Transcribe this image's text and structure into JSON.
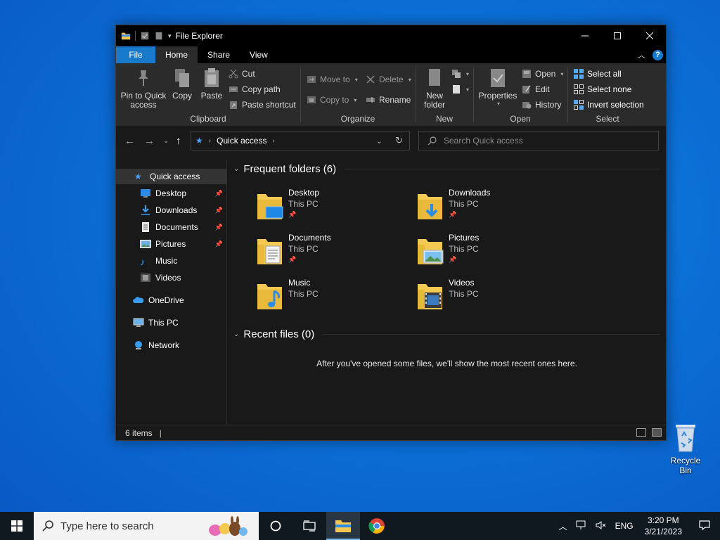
{
  "window": {
    "title": "File Explorer",
    "ribbon_tabs": [
      "File",
      "Home",
      "Share",
      "View"
    ],
    "help": "?"
  },
  "ribbon": {
    "clipboard": {
      "label": "Clipboard",
      "pin": "Pin to Quick access",
      "copy": "Copy",
      "paste": "Paste",
      "cut": "Cut",
      "copy_path": "Copy path",
      "paste_shortcut": "Paste shortcut"
    },
    "organize": {
      "label": "Organize",
      "move_to": "Move to",
      "copy_to": "Copy to",
      "delete": "Delete",
      "rename": "Rename"
    },
    "new": {
      "label": "New",
      "new_folder": "New folder"
    },
    "open": {
      "label": "Open",
      "properties": "Properties",
      "open": "Open",
      "edit": "Edit",
      "history": "History"
    },
    "select": {
      "label": "Select",
      "select_all": "Select all",
      "select_none": "Select none",
      "invert": "Invert selection"
    }
  },
  "address": {
    "crumb": "Quick access",
    "search_placeholder": "Search Quick access"
  },
  "nav": {
    "quick_access": "Quick access",
    "desktop": "Desktop",
    "downloads": "Downloads",
    "documents": "Documents",
    "pictures": "Pictures",
    "music": "Music",
    "videos": "Videos",
    "onedrive": "OneDrive",
    "this_pc": "This PC",
    "network": "Network"
  },
  "content": {
    "frequent_header": "Frequent folders (6)",
    "recent_header": "Recent files (0)",
    "empty_message": "After you've opened some files, we'll show the most recent ones here.",
    "folders": [
      {
        "name": "Desktop",
        "location": "This PC"
      },
      {
        "name": "Downloads",
        "location": "This PC"
      },
      {
        "name": "Documents",
        "location": "This PC"
      },
      {
        "name": "Pictures",
        "location": "This PC"
      },
      {
        "name": "Music",
        "location": "This PC"
      },
      {
        "name": "Videos",
        "location": "This PC"
      }
    ]
  },
  "status": {
    "items": "6 items"
  },
  "desktop": {
    "recycle_bin": "Recycle Bin"
  },
  "taskbar": {
    "search_placeholder": "Type here to search",
    "language": "ENG",
    "time": "3:20 PM",
    "date": "3/21/2023"
  },
  "colors": {
    "accent": "#1979ca",
    "folder_yellow": "#f3c952",
    "window_bg": "#191919",
    "ribbon_bg": "#2b2b2b"
  }
}
